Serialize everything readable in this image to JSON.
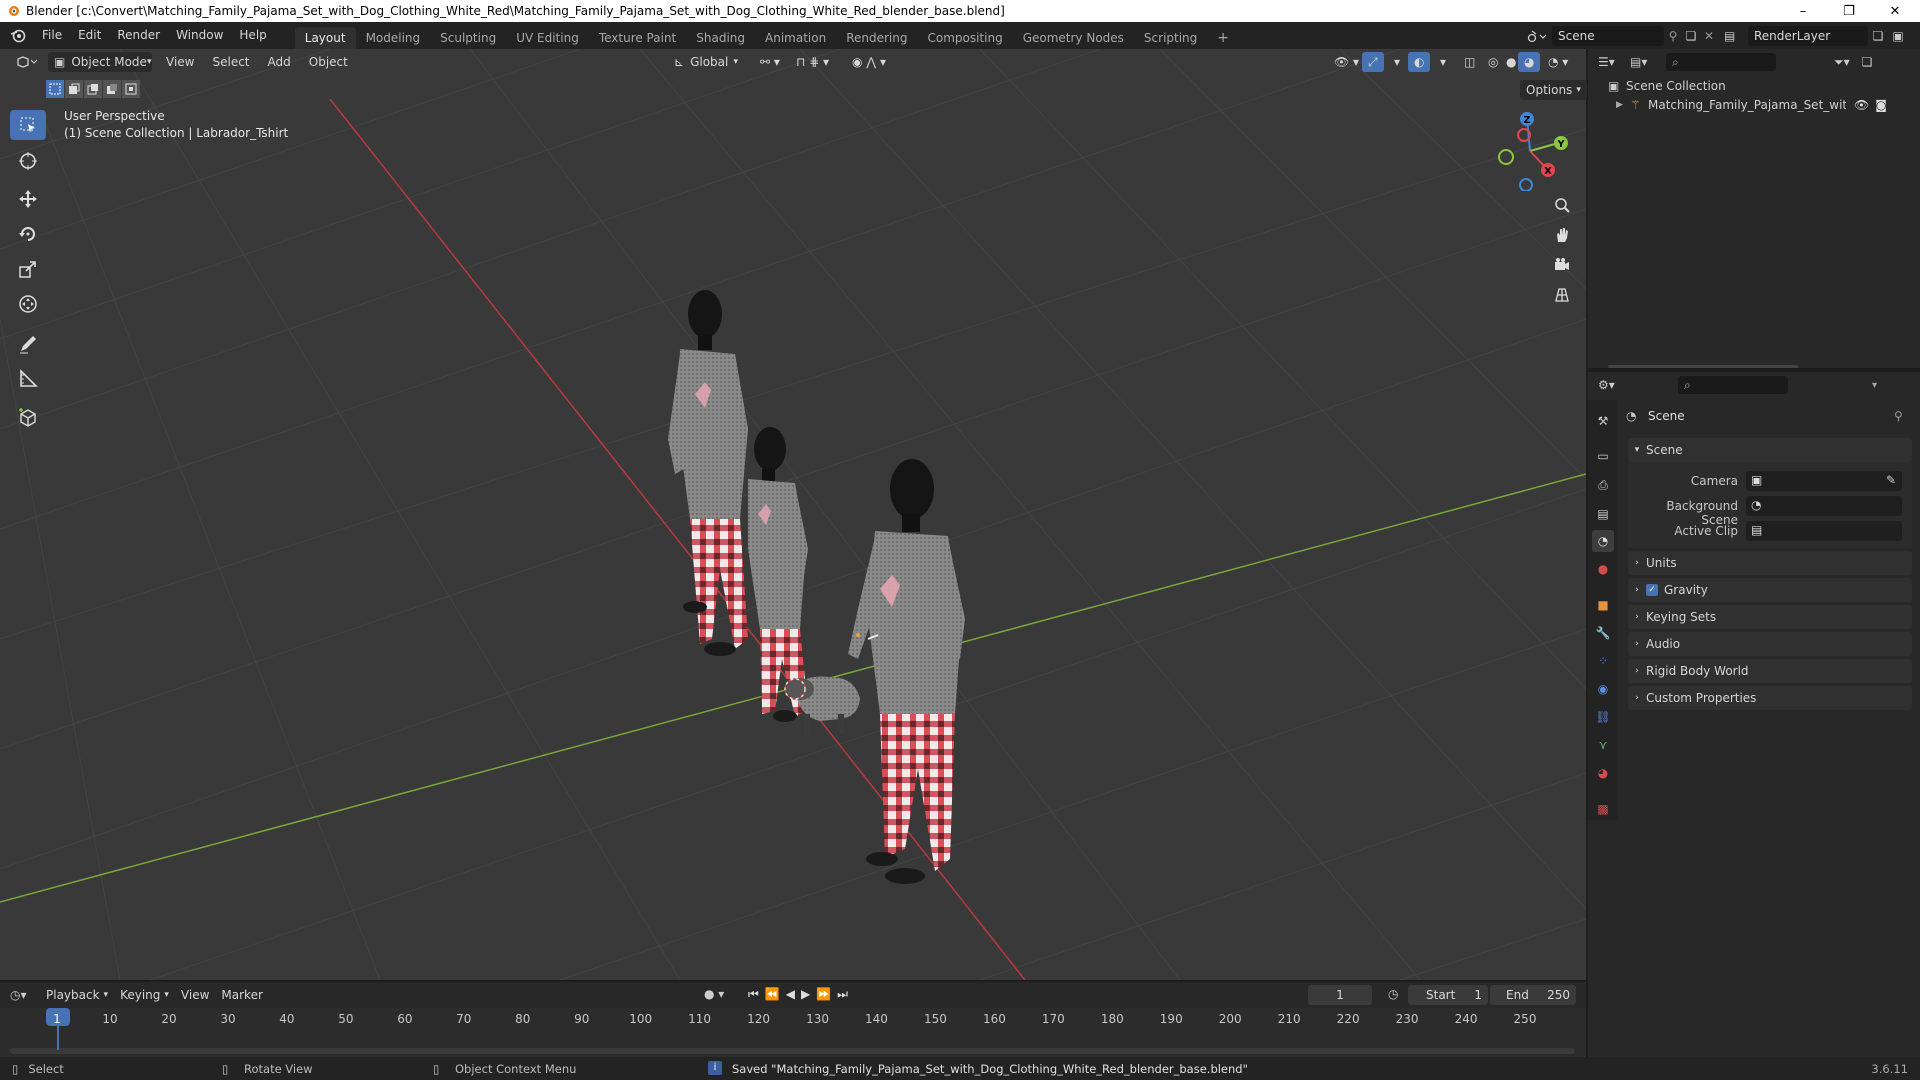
{
  "window": {
    "title": "Blender [c:\\Convert\\Matching_Family_Pajama_Set_with_Dog_Clothing_White_Red\\Matching_Family_Pajama_Set_with_Dog_Clothing_White_Red_blender_base.blend]",
    "controls": [
      "–",
      "❐",
      "✕"
    ]
  },
  "menu": [
    "File",
    "Edit",
    "Render",
    "Window",
    "Help"
  ],
  "workspaces": [
    {
      "label": "Layout",
      "active": true
    },
    {
      "label": "Modeling"
    },
    {
      "label": "Sculpting"
    },
    {
      "label": "UV Editing"
    },
    {
      "label": "Texture Paint"
    },
    {
      "label": "Shading"
    },
    {
      "label": "Animation"
    },
    {
      "label": "Rendering"
    },
    {
      "label": "Compositing"
    },
    {
      "label": "Geometry Nodes"
    },
    {
      "label": "Scripting"
    }
  ],
  "add_workspace": "+",
  "scene_selector": {
    "value": "Scene"
  },
  "view_layer": {
    "value": "RenderLayer"
  },
  "viewport": {
    "mode": "Object Mode",
    "menus": [
      "View",
      "Select",
      "Add",
      "Object"
    ],
    "transform_orientation": "Global",
    "options_label": "Options",
    "overlay_title": "User Perspective",
    "overlay_subtitle": "(1) Scene Collection | Labrador_Tshirt",
    "axes": {
      "x": "X",
      "y": "Y",
      "z": "Z"
    }
  },
  "outliner": {
    "root": "Scene Collection",
    "items": [
      {
        "label": "Matching_Family_Pajama_Set_with_Dog"
      }
    ]
  },
  "properties": {
    "header": "Scene",
    "section_scene": "Scene",
    "fields": [
      {
        "label": "Camera"
      },
      {
        "label": "Background Scene"
      },
      {
        "label": "Active Clip"
      }
    ],
    "panels": [
      {
        "label": "Units",
        "checkbox": false
      },
      {
        "label": "Gravity",
        "checkbox": true
      },
      {
        "label": "Keying Sets",
        "checkbox": false
      },
      {
        "label": "Audio",
        "checkbox": false
      },
      {
        "label": "Rigid Body World",
        "checkbox": false
      },
      {
        "label": "Custom Properties",
        "checkbox": false
      }
    ]
  },
  "timeline": {
    "menus": [
      "Playback",
      "Keying",
      "View",
      "Marker"
    ],
    "current_frame": "1",
    "start_label": "Start",
    "start_value": "1",
    "end_label": "End",
    "end_value": "250",
    "ticks": [
      "1",
      "10",
      "20",
      "30",
      "40",
      "50",
      "60",
      "70",
      "80",
      "90",
      "100",
      "110",
      "120",
      "130",
      "140",
      "150",
      "160",
      "170",
      "180",
      "190",
      "200",
      "210",
      "220",
      "230",
      "240",
      "250"
    ]
  },
  "statusbar": {
    "select": "Select",
    "rotate": "Rotate View",
    "context": "Object Context Menu",
    "message": "Saved \"Matching_Family_Pajama_Set_with_Dog_Clothing_White_Red_blender_base.blend\"",
    "version": "3.6.11"
  },
  "colors": {
    "accent": "#4772b3",
    "x_axis": "#e0464f",
    "y_axis": "#8bc640",
    "z_axis": "#3f86d8"
  }
}
